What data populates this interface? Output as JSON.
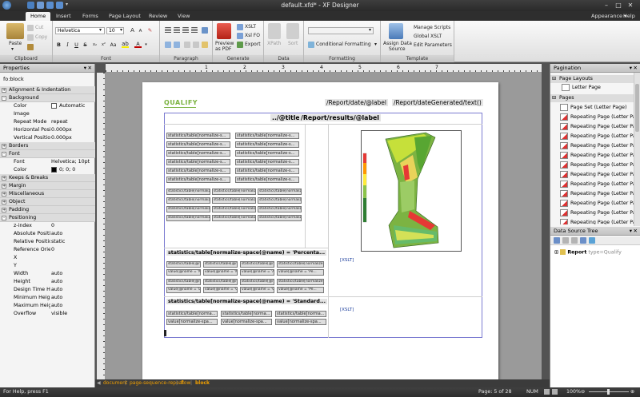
{
  "window": {
    "title": "default.xfd* - XF Designer",
    "controls": {
      "minimize": "–",
      "maximize": "□",
      "close": "✕"
    }
  },
  "ribbon_tabs": [
    "Home",
    "Insert",
    "Forms",
    "Page Layout",
    "Review",
    "View"
  ],
  "ribbon_right": {
    "appearance": "Appearance ▾",
    "help": "Help ▾"
  },
  "ribbon": {
    "clipboard": {
      "paste": "Paste",
      "cut": "Cut",
      "copy": "Copy",
      "label": "Clipboard"
    },
    "font": {
      "family": "Helvetica",
      "size": "10",
      "label": "Font"
    },
    "paragraph": {
      "label": "Paragraph"
    },
    "generate": {
      "preview": "Preview",
      "preview2": "as PDF",
      "xslt": "XSLT",
      "xslfo": "Xsl FO",
      "export": "Export",
      "label": "Generate"
    },
    "data": {
      "xpath": "XPath",
      "sort": "Sort",
      "label": "Data"
    },
    "formatting": {
      "conditional": "Conditional Formatting",
      "label": "Formatting"
    },
    "template": {
      "assign1": "Assign Data",
      "assign2": "Source",
      "manage": "Manage Scripts",
      "global": "Global XSLT",
      "edit": "Edit Parameters",
      "label": "Template"
    }
  },
  "properties": {
    "title": "Properties",
    "element": "fo:block",
    "rows": [
      {
        "type": "cat",
        "exp": "+",
        "name": "Alignment & Indentation"
      },
      {
        "type": "cat",
        "exp": "-",
        "name": "Background"
      },
      {
        "type": "prop",
        "name": "Color",
        "value": "Automatic",
        "swatch": "#ffffff"
      },
      {
        "type": "prop",
        "name": "Image",
        "value": ""
      },
      {
        "type": "prop",
        "name": "Repeat Mode",
        "value": "repeat"
      },
      {
        "type": "prop",
        "name": "Horizontal Posi",
        "value": "0.000px"
      },
      {
        "type": "prop",
        "name": "Vertical Position",
        "value": "0.000px"
      },
      {
        "type": "cat",
        "exp": "+",
        "name": "Borders"
      },
      {
        "type": "cat",
        "exp": "-",
        "name": "Font"
      },
      {
        "type": "prop",
        "name": "Font",
        "value": "Helvetica; 10pt"
      },
      {
        "type": "prop",
        "name": "Color",
        "value": "0; 0; 0",
        "swatch": "#000000"
      },
      {
        "type": "cat",
        "exp": "+",
        "name": "Keeps & Breaks"
      },
      {
        "type": "cat",
        "exp": "+",
        "name": "Margin"
      },
      {
        "type": "cat",
        "exp": "+",
        "name": "Miscellaneous"
      },
      {
        "type": "cat",
        "exp": "+",
        "name": "Object"
      },
      {
        "type": "cat",
        "exp": "+",
        "name": "Padding"
      },
      {
        "type": "cat",
        "exp": "-",
        "name": "Positioning"
      },
      {
        "type": "prop",
        "name": "z-index",
        "value": "0"
      },
      {
        "type": "prop",
        "name": "Absolute Positio",
        "value": "auto"
      },
      {
        "type": "prop",
        "name": "Relative Positio",
        "value": "static"
      },
      {
        "type": "prop",
        "name": "Reference Orier",
        "value": "0"
      },
      {
        "type": "prop",
        "name": "X",
        "value": ""
      },
      {
        "type": "prop",
        "name": "Y",
        "value": ""
      },
      {
        "type": "prop",
        "name": "Width",
        "value": "auto"
      },
      {
        "type": "prop",
        "name": "Height",
        "value": "auto"
      },
      {
        "type": "prop",
        "name": "Design Time He",
        "value": "auto"
      },
      {
        "type": "prop",
        "name": "Minimum Heig",
        "value": "auto"
      },
      {
        "type": "prop",
        "name": "Maximum Heig",
        "value": "auto"
      },
      {
        "type": "prop",
        "name": "Overflow",
        "value": "visible"
      }
    ]
  },
  "ruler_numbers": [
    "1",
    "2",
    "3",
    "4",
    "5",
    "6",
    "7"
  ],
  "document": {
    "logo": "QUALIFY",
    "header_path1": "/Report/date/@label",
    "header_path2": "/Report/dateGenerated/text()",
    "title_path1": "../@title",
    "title_path2": "/Report/results/@label",
    "stat_cell": "statistics/table[normalize-s...",
    "stat_cell_small": "statistics/table[normalize-space(@n...",
    "block2_heading": "statistics/table[normalize-space(@name) = 'Percenta...",
    "block2_cells_a": [
      "statistics/table[@n...",
      "statistics/table[@n...",
      "statistics/table[@n...",
      "statistics/table[normalize-spa..."
    ],
    "block2_cells_b": [
      "value[@name = 'Min']",
      "value[@name = 'Max']",
      "value[@name = 'A...",
      "value[@name = 'Pe..."
    ],
    "block2_cells_c": [
      "value[@name = 'D...",
      "value[@name = 'Q...",
      "value[@name = 'Q...",
      "value[@name = 'Pe..."
    ],
    "block3_heading": "statistics/table[normalize-space(@name) = 'Standard...",
    "block3_cells_a": [
      "statistics/table[norma...",
      "statistics/table[norma...",
      "statistics/table[norma..."
    ],
    "block3_cells_b": [
      "value[normalize-spa...",
      "value[normalize-spa...",
      "value[normalize-spa..."
    ],
    "xslt_tag": "[XSLT]"
  },
  "pagination": {
    "title": "Pagination",
    "cat_layouts": "Page Layouts",
    "layout_item": "Letter Page",
    "cat_pages": "Pages",
    "pages": [
      "Page Set (Letter Page)",
      "Repeating Page (Letter Page)",
      "Repeating Page (Letter Page)",
      "Repeating Page (Letter Page)",
      "Repeating Page (Letter Page)",
      "Repeating Page (Letter Page)",
      "Repeating Page (Letter Page)",
      "Repeating Page (Letter Page)",
      "Repeating Page (Letter Page)",
      "Repeating Page (Letter Page)",
      "Repeating Page (Letter Page)",
      "Repeating Page (Letter Page)",
      "Repeating Page (Letter Page)"
    ]
  },
  "datasource": {
    "title": "Data Source Tree",
    "root_name": "Report",
    "root_type": "type=Qualify"
  },
  "breadcrumb": [
    "document",
    "page-sequence-repeat",
    "flow",
    "block"
  ],
  "status": {
    "left": "For Help, press F1",
    "page": "Page: 5 of 28",
    "mode": "NUM",
    "zoom": "100%"
  }
}
